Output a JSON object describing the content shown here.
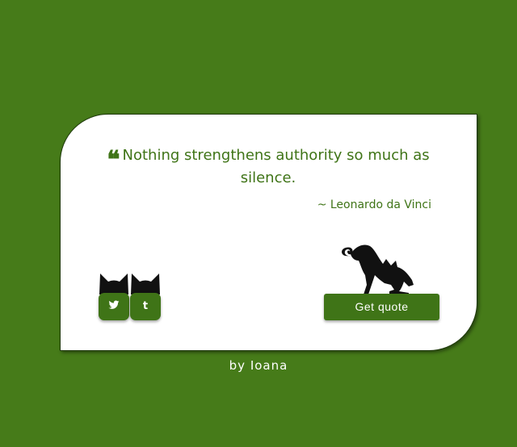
{
  "colors": {
    "background": "#467b19",
    "accent": "#3f7417",
    "card": "#ffffff",
    "cat": "#111111"
  },
  "quote": {
    "mark": "❝",
    "text": "Nothing strengthens authority so much as silence.",
    "author": "~ Leonardo da Vinci"
  },
  "social": {
    "twitter_glyph": "🐦",
    "twitter_icon": "twitter-icon",
    "tumblr_glyph": "t",
    "tumblr_icon": "tumblr-icon"
  },
  "actions": {
    "get_quote_label": "Get quote"
  },
  "footer": {
    "byline": "by Ioana"
  },
  "decorations": {
    "cat_heads": "cat-head-icon",
    "stretching_cat": "stretching-cat-icon"
  }
}
